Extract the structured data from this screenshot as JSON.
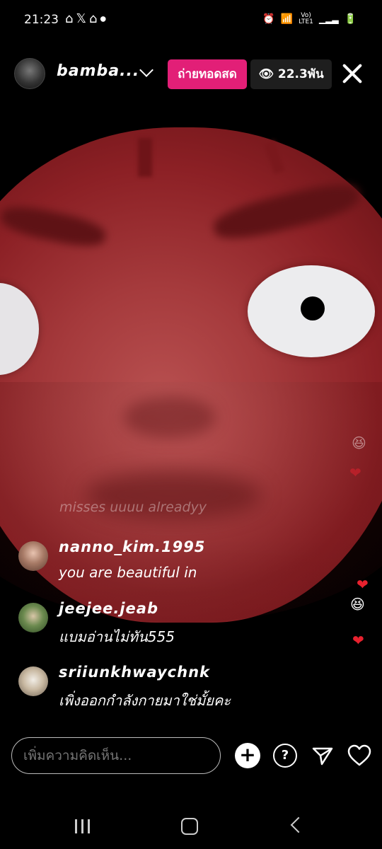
{
  "status_bar": {
    "time": "21:23",
    "notification_icons": [
      "home-icon",
      "x-icon",
      "home-icon",
      "dot-icon"
    ],
    "system_icons": [
      "alarm-icon",
      "wifi-icon",
      "volte-lte-icon",
      "signal-icon",
      "battery-charging-icon"
    ],
    "network_label_top": "Vo)",
    "network_label_bottom": "LTE1"
  },
  "header": {
    "username": "bamba...",
    "live_label": "ถ่ายทอดสด",
    "viewer_count": "22.3พัน"
  },
  "comments": {
    "faded_text": "misses uuuu alreadyy",
    "items": [
      {
        "username": "nanno_kim.1995",
        "text": "you are beautiful in"
      },
      {
        "username": "jeejee.jeab",
        "text": "แบมอ่านไม่ทัน555"
      },
      {
        "username": "sriiunkhwaychnk",
        "text": "เพิ่งออกกำลังกายมาใช่มั้ยคะ"
      }
    ]
  },
  "reactions": [
    "😆",
    "❤",
    "❤",
    "😆",
    "❤"
  ],
  "bottom_bar": {
    "comment_placeholder": "เพิ่มความคิดเห็น..."
  },
  "colors": {
    "live_badge": "#e21f77",
    "heart": "#e8212e"
  }
}
